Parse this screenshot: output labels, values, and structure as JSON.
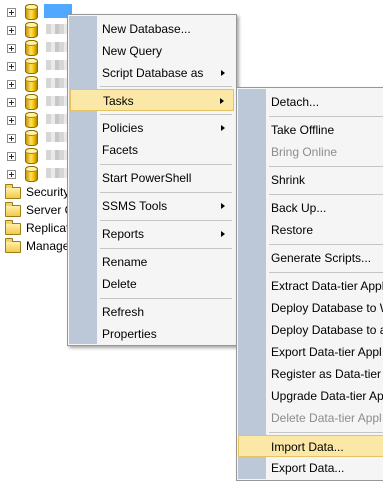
{
  "tree": {
    "database_rows": 10,
    "folders": [
      {
        "label": "Security"
      },
      {
        "label": "Server O"
      },
      {
        "label": "Replicat"
      },
      {
        "label": "Manage"
      }
    ]
  },
  "main_menu": {
    "items": [
      {
        "label": "New Database...",
        "submenu": false
      },
      {
        "label": "New Query",
        "submenu": false
      },
      {
        "label": "Script Database as",
        "submenu": true
      },
      {
        "label": "Tasks",
        "submenu": true
      },
      {
        "label": "Policies",
        "submenu": true
      },
      {
        "label": "Facets",
        "submenu": false
      },
      {
        "label": "Start PowerShell",
        "submenu": false
      },
      {
        "label": "SSMS Tools",
        "submenu": true
      },
      {
        "label": "Reports",
        "submenu": true
      },
      {
        "label": "Rename",
        "submenu": false
      },
      {
        "label": "Delete",
        "submenu": false
      },
      {
        "label": "Refresh",
        "submenu": false
      },
      {
        "label": "Properties",
        "submenu": false
      }
    ],
    "highlighted": "Tasks"
  },
  "tasks_menu": {
    "items": [
      {
        "label": "Detach...",
        "enabled": true
      },
      {
        "label": "Take Offline",
        "enabled": true
      },
      {
        "label": "Bring Online",
        "enabled": false
      },
      {
        "label": "Shrink",
        "enabled": true
      },
      {
        "label": "Back Up...",
        "enabled": true
      },
      {
        "label": "Restore",
        "enabled": true
      },
      {
        "label": "Generate Scripts...",
        "enabled": true
      },
      {
        "label": "Extract Data-tier Appl",
        "enabled": true
      },
      {
        "label": "Deploy Database to W",
        "enabled": true
      },
      {
        "label": "Deploy Database to a",
        "enabled": true
      },
      {
        "label": "Export Data-tier Appl",
        "enabled": true
      },
      {
        "label": "Register as Data-tier A",
        "enabled": true
      },
      {
        "label": "Upgrade Data-tier Ap",
        "enabled": true
      },
      {
        "label": "Delete Data-tier Appl",
        "enabled": false
      },
      {
        "label": "Import Data...",
        "enabled": true
      },
      {
        "label": "Export Data...",
        "enabled": true
      }
    ],
    "highlighted": "Import Data..."
  },
  "colors": {
    "menu_background": "#f5f5f5",
    "menu_gutter": "#bcc7d8",
    "highlight_fill": "#fbe7a6",
    "highlight_border": "#e5c365",
    "selection": "#3399ff",
    "disabled_text": "#8d8d8d"
  }
}
